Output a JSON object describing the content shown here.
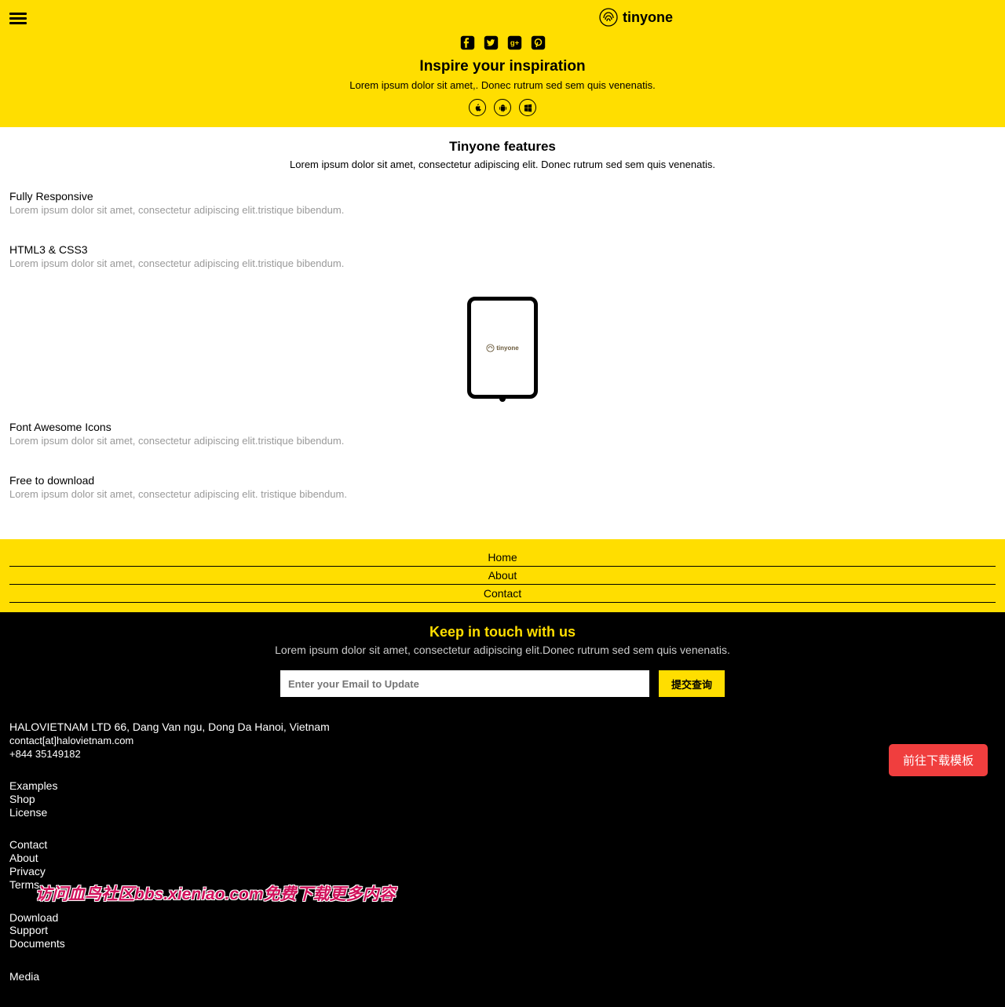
{
  "hero": {
    "logo_text": "tinyone",
    "headline": "Inspire your inspiration",
    "subline": "Lorem ipsum dolor sit amet,. Donec rutrum sed sem quis venenatis."
  },
  "features_section": {
    "title": "Tinyone features",
    "subtitle": "Lorem ipsum dolor sit amet, consectetur adipiscing elit. Donec rutrum sed sem quis venenatis.",
    "device_text": "tinyone",
    "items": [
      {
        "title": "Fully Responsive",
        "desc": "Lorem ipsum dolor sit amet, consectetur adipiscing elit.tristique bibendum."
      },
      {
        "title": "HTML3 & CSS3",
        "desc": "Lorem ipsum dolor sit amet, consectetur adipiscing elit.tristique bibendum."
      },
      {
        "title": "Font Awesome Icons",
        "desc": "Lorem ipsum dolor sit amet, consectetur adipiscing elit.tristique bibendum."
      },
      {
        "title": "Free to download",
        "desc": "Lorem ipsum dolor sit amet, consectetur adipiscing elit. tristique bibendum."
      }
    ]
  },
  "nav": {
    "items": [
      "Home",
      "About",
      "Contact"
    ]
  },
  "footer": {
    "title": "Keep in touch with us",
    "subtitle": "Lorem ipsum dolor sit amet, consectetur adipiscing elit.Donec rutrum sed sem quis venenatis.",
    "email_placeholder": "Enter your Email to Update",
    "submit_label": "提交查询",
    "address": "HALOVIETNAM LTD 66, Dang Van ngu, Dong Da Hanoi, Vietnam",
    "email": "contact[at]halovietnam.com",
    "phone": "+844 35149182",
    "group1": [
      "Examples",
      "Shop",
      "License"
    ],
    "group2": [
      "Contact",
      "About",
      "Privacy",
      "Terms"
    ],
    "group3": [
      "Download",
      "Support",
      "Documents"
    ],
    "group4_first": "Media"
  },
  "watermark": "访问血鸟社区bbs.xieniao.com免费下载更多内容",
  "download_button": "前往下载模板",
  "icons": {
    "facebook": "facebook-icon",
    "twitter": "twitter-icon",
    "google": "google-plus-icon",
    "pinterest": "pinterest-icon",
    "apple": "apple-icon",
    "android": "android-icon",
    "windows": "windows-icon",
    "fingerprint": "fingerprint-icon"
  }
}
